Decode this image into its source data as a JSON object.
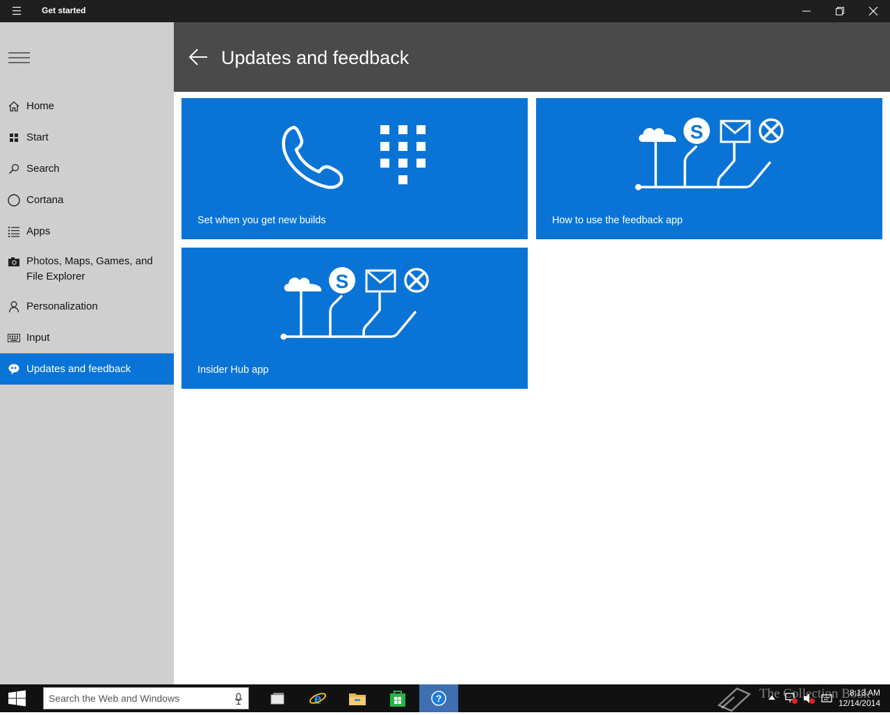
{
  "window": {
    "title": "Get started",
    "controls": [
      "minimize-icon",
      "restore-icon",
      "close-icon"
    ]
  },
  "sidebar": {
    "items": [
      {
        "label": "Home",
        "icon": "home-icon"
      },
      {
        "label": "Start",
        "icon": "start-tiles-icon"
      },
      {
        "label": "Search",
        "icon": "search-icon"
      },
      {
        "label": "Cortana",
        "icon": "cortana-circle-icon"
      },
      {
        "label": "Apps",
        "icon": "list-icon"
      },
      {
        "label": "Photos, Maps, Games, and File Explorer",
        "icon": "camera-icon"
      },
      {
        "label": "Personalization",
        "icon": "person-icon"
      },
      {
        "label": "Input",
        "icon": "keyboard-icon"
      },
      {
        "label": "Updates and feedback",
        "icon": "feedback-bubble-icon",
        "active": true
      }
    ]
  },
  "header": {
    "title": "Updates and feedback"
  },
  "tiles": [
    {
      "caption": "Set when you get new builds"
    },
    {
      "caption": "How to use the feedback app"
    },
    {
      "caption": "Insider Hub app"
    }
  ],
  "taskbar": {
    "search_placeholder": "Search the Web and Windows",
    "watermark": "The Collection Book",
    "time": "8:13 AM",
    "date": "12/14/2014"
  },
  "colors": {
    "accent": "#0a74d6",
    "header_bg": "#4a4a4a",
    "sidebar_bg": "#cfcfcf",
    "titlebar_bg": "#1f1f1f",
    "taskbar_bg": "#111111"
  }
}
